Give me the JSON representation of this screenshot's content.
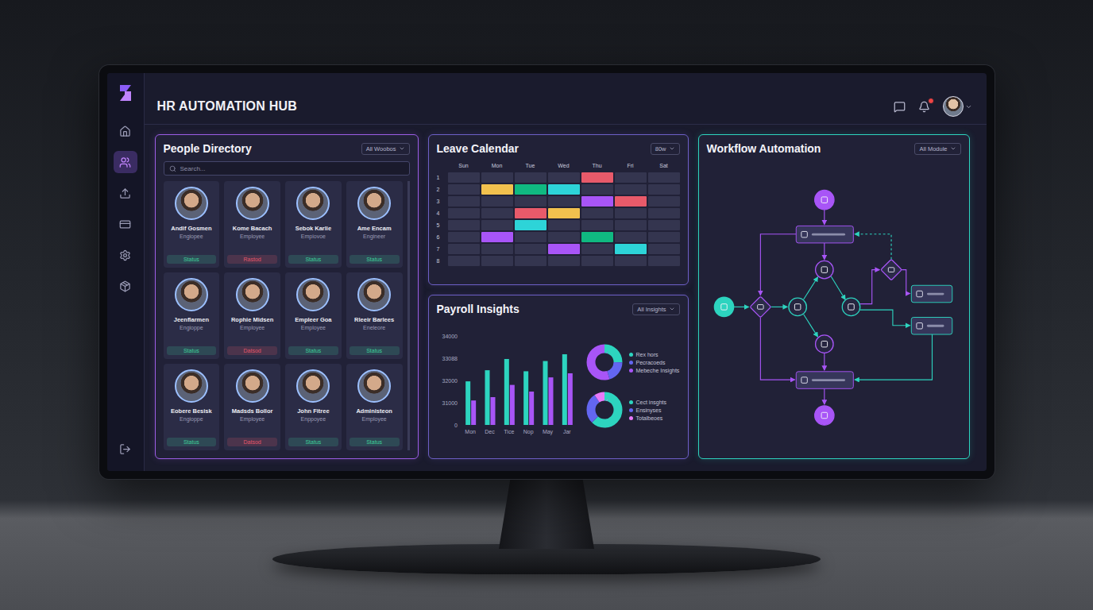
{
  "app": {
    "title": "HR AUTOMATION HUB"
  },
  "header": {
    "notifications": true
  },
  "sidebar": {
    "items": [
      {
        "selected": false
      },
      {
        "selected": true
      },
      {
        "selected": false
      },
      {
        "selected": false
      },
      {
        "selected": false
      },
      {
        "selected": false
      }
    ],
    "logout": {
      "selected": false
    }
  },
  "people_directory": {
    "title": "People Directory",
    "filter": "All Woobos",
    "search_placeholder": "Search...",
    "people": [
      {
        "name": "Andif Gosmen",
        "role": "Engiopee",
        "status": "Status",
        "color": "#3ecf9a"
      },
      {
        "name": "Kome Bacach",
        "role": "Employee",
        "status": "Rastod",
        "color": "#e2566a"
      },
      {
        "name": "Sebok Karlie",
        "role": "Empiovoe",
        "status": "Status",
        "color": "#3ecf9a"
      },
      {
        "name": "Ame Encam",
        "role": "Engineer",
        "status": "Status",
        "color": "#3ecf9a"
      },
      {
        "name": "Jeenflarmen",
        "role": "Engioppe",
        "status": "Status",
        "color": "#3ecf9a"
      },
      {
        "name": "Rophie Midsen",
        "role": "Employee",
        "status": "Datsod",
        "color": "#e2566a"
      },
      {
        "name": "Empleer Goa",
        "role": "Employee",
        "status": "Status",
        "color": "#3ecf9a"
      },
      {
        "name": "Rleeir Barlees",
        "role": "Eneleore",
        "status": "Status",
        "color": "#3ecf9a"
      },
      {
        "name": "Eobere Besisk",
        "role": "Engioppe",
        "status": "Status",
        "color": "#3ecf9a"
      },
      {
        "name": "Madsds Bollor",
        "role": "Employee",
        "status": "Datsod",
        "color": "#e2566a"
      },
      {
        "name": "John Fitree",
        "role": "Enppoyee",
        "status": "Status",
        "color": "#3ecf9a"
      },
      {
        "name": "Administeon",
        "role": "Employee",
        "status": "Status",
        "color": "#3ecf9a"
      }
    ]
  },
  "leave_calendar": {
    "title": "Leave Calendar",
    "filter": "80w",
    "days": [
      "Sun",
      "Mon",
      "Tue",
      "Wed",
      "Thu",
      "Fri",
      "Sat"
    ],
    "rows": [
      {
        "label": "1",
        "cells": [
          null,
          null,
          null,
          null,
          "#e85a6a",
          null,
          null
        ]
      },
      {
        "label": "2",
        "cells": [
          null,
          "#f2c14e",
          "#10b981",
          "#2dd4d8",
          null,
          null,
          null
        ]
      },
      {
        "label": "3",
        "cells": [
          null,
          null,
          null,
          null,
          "#a855f7",
          "#e85a6a",
          null
        ]
      },
      {
        "label": "4",
        "cells": [
          null,
          null,
          "#e85a6a",
          "#f2c14e",
          null,
          null,
          null
        ]
      },
      {
        "label": "5",
        "cells": [
          null,
          null,
          "#2dd4d8",
          null,
          null,
          null,
          null
        ]
      },
      {
        "label": "6",
        "cells": [
          null,
          "#a855f7",
          null,
          null,
          "#10b981",
          null,
          null
        ]
      },
      {
        "label": "7",
        "cells": [
          null,
          null,
          null,
          "#a855f7",
          null,
          "#2dd4d8",
          null
        ]
      },
      {
        "label": "8",
        "cells": [
          null,
          null,
          null,
          null,
          null,
          null,
          null
        ]
      }
    ]
  },
  "payroll": {
    "title": "Payroll Insights",
    "filter": "All Insights",
    "y_ticks": [
      "34000",
      "33088",
      "32000",
      "31000",
      "0"
    ],
    "x_labels": [
      "Mon",
      "Dec",
      "Tice",
      "Nop",
      "May",
      "Jar"
    ],
    "series": [
      {
        "color": "#2dd4bf",
        "values": [
          31960,
          32500,
          33050,
          32450,
          32950,
          33250
        ]
      },
      {
        "color": "#a855f7",
        "values": [
          31100,
          31250,
          31800,
          31500,
          32150,
          32350
        ]
      }
    ],
    "donuts": [
      {
        "segments": [
          {
            "label": "Rex hors",
            "value": 25,
            "color": "#2dd4bf"
          },
          {
            "label": "Pecracoeds",
            "value": 20,
            "color": "#6366f1"
          },
          {
            "label": "Mebeche Insights",
            "value": 55,
            "color": "#a855f7"
          }
        ]
      },
      {
        "segments": [
          {
            "label": "Cect insghts",
            "value": 62,
            "color": "#2dd4bf"
          },
          {
            "label": "Ensinyses",
            "value": 28,
            "color": "#6366f1"
          },
          {
            "label": "Totalbeoes",
            "value": 10,
            "color": "#e879f9"
          }
        ]
      }
    ]
  },
  "workflow": {
    "title": "Workflow Automation",
    "filter": "All Module",
    "nodes": [
      {
        "kind": "circle-filled",
        "color": "#a855f7"
      },
      {
        "kind": "rect",
        "color": "#a855f7"
      },
      {
        "kind": "circle-outline",
        "color": "#a855f7"
      },
      {
        "kind": "diamond",
        "color": "#a855f7"
      },
      {
        "kind": "circle-filled",
        "color": "#2dd4bf"
      },
      {
        "kind": "diamond",
        "color": "#a855f7"
      },
      {
        "kind": "circle-outline",
        "color": "#2dd4bf"
      },
      {
        "kind": "circle-outline",
        "color": "#2dd4bf"
      },
      {
        "kind": "rect",
        "color": "#2dd4bf"
      },
      {
        "kind": "rect",
        "color": "#2dd4bf"
      },
      {
        "kind": "circle-outline",
        "color": "#a855f7"
      },
      {
        "kind": "rect",
        "color": "#a855f7"
      },
      {
        "kind": "circle-filled",
        "color": "#a855f7"
      }
    ]
  }
}
